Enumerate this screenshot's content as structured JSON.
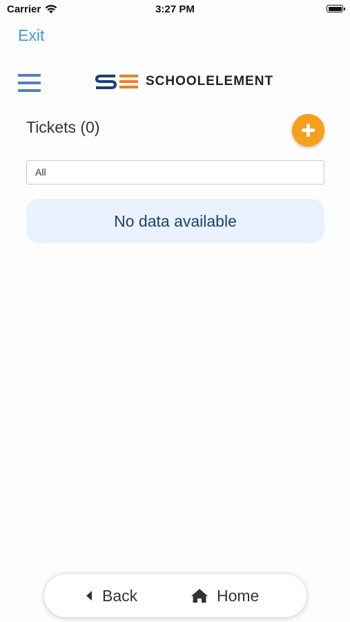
{
  "status_bar": {
    "carrier": "Carrier",
    "time": "3:27 PM"
  },
  "exit_label": "Exit",
  "brand": {
    "text": "SCHOOLELEMENT",
    "colors": {
      "primary": "#1a3d7c",
      "accent": "#f47b20"
    }
  },
  "tickets": {
    "title": "Tickets (0)",
    "add_icon": "plus-icon",
    "filter_value": "All",
    "empty_message": "No data available"
  },
  "bottom_nav": {
    "back_label": "Back",
    "home_label": "Home"
  },
  "colors": {
    "link": "#3a99e0",
    "menu_icon": "#4e7ec8",
    "add_button": "#f6a01c",
    "empty_bg": "#e9f2fd",
    "empty_text": "#1e3f73"
  }
}
